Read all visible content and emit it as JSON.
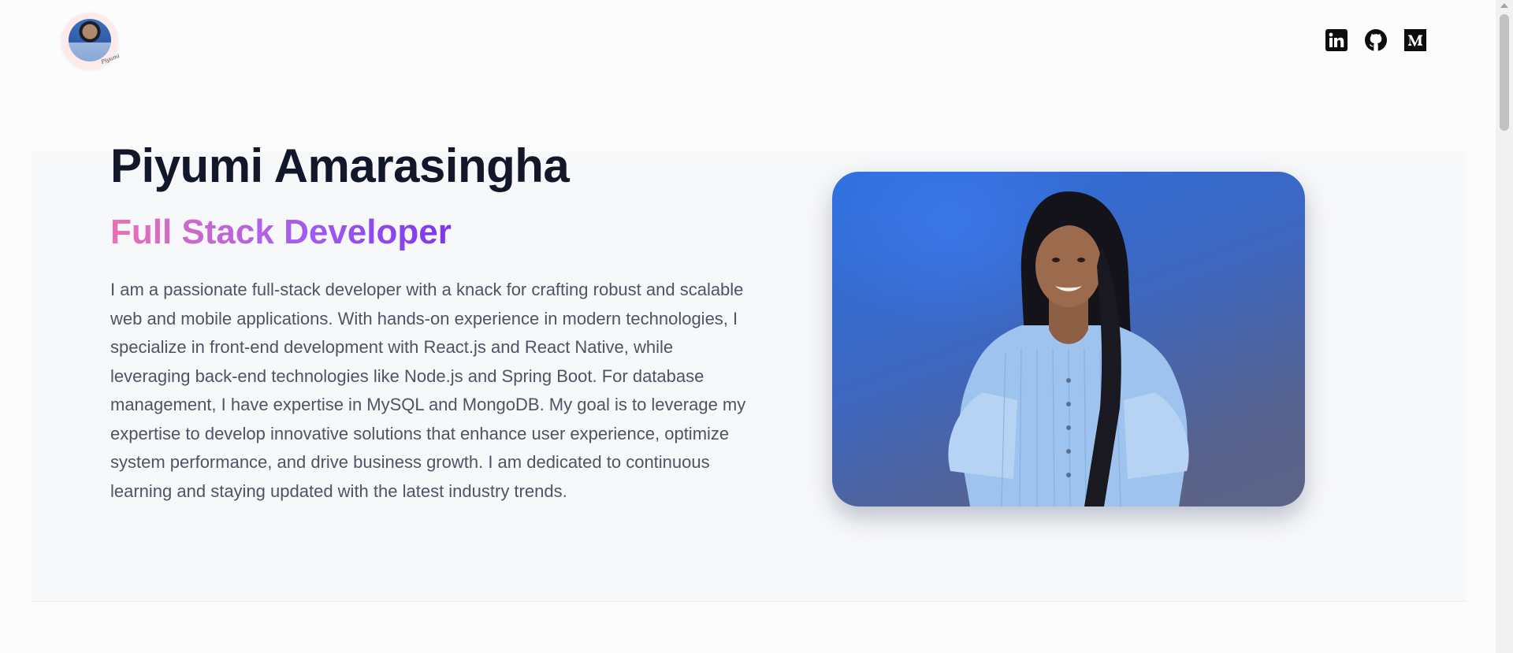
{
  "header": {
    "logo_alt": "Piyumi",
    "logo_signature": "Piyumi",
    "socials": [
      {
        "name": "LinkedIn",
        "icon": "linkedin-icon"
      },
      {
        "name": "GitHub",
        "icon": "github-icon"
      },
      {
        "name": "Medium",
        "icon": "medium-icon"
      }
    ]
  },
  "hero": {
    "name": "Piyumi Amarasingha",
    "role": "Full Stack Developer",
    "bio": "I am a passionate full-stack developer with a knack for crafting robust and scalable web and mobile applications. With hands-on experience in modern technologies, I specialize in front-end development with React.js and React Native, while leveraging back-end technologies like Node.js and Spring Boot. For database management, I have expertise in MySQL and MongoDB. My goal is to leverage my expertise to develop innovative solutions that enhance user experience, optimize system performance, and drive business growth. I am dedicated to continuous learning and staying updated with the latest industry trends.",
    "photo_alt": "Piyumi Amarasingha"
  },
  "colors": {
    "name_text": "#121829",
    "role_gradient_start": "#ec6fb3",
    "role_gradient_end": "#7b36f0",
    "bio_text": "#4b5563",
    "hero_background": "#f7f8fa"
  }
}
